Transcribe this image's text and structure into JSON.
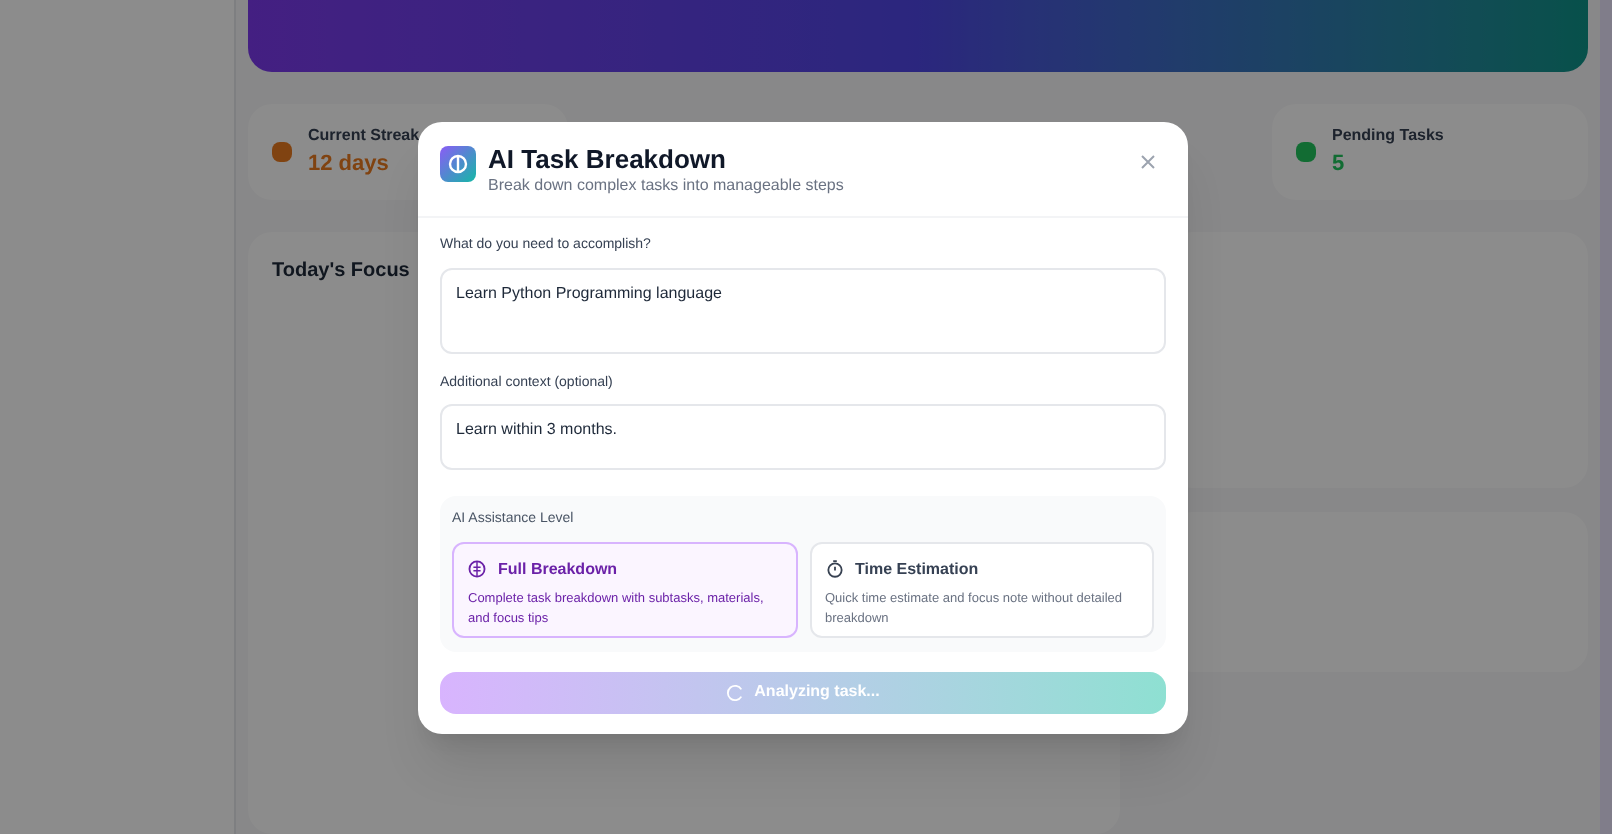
{
  "background": {
    "stats": [
      {
        "label": "Current Streak",
        "value": "12 days",
        "kind": "streak"
      },
      {
        "label": "Pending Tasks",
        "value": "5",
        "kind": "pending"
      }
    ],
    "focus_title": "Today's Focus"
  },
  "dialog": {
    "title": "AI Task Breakdown",
    "subtitle": "Break down complex tasks into manageable steps",
    "fields": [
      {
        "label": "What do you need to accomplish?",
        "value": "Learn Python Programming language",
        "kind": "tall"
      },
      {
        "label": "Additional context (optional)",
        "value": "Learn within 3 months.",
        "kind": "short"
      }
    ],
    "assistance": {
      "label": "AI Assistance Level",
      "options": [
        {
          "kind": "full",
          "title": "Full Breakdown",
          "description": "Complete task breakdown with subtasks, materials, and focus tips",
          "selected": true
        },
        {
          "kind": "time",
          "title": "Time Estimation",
          "description": "Quick time estimate and focus note without detailed breakdown",
          "selected": false
        }
      ]
    },
    "submit": {
      "label": "Analyzing task...",
      "loading": true
    }
  }
}
